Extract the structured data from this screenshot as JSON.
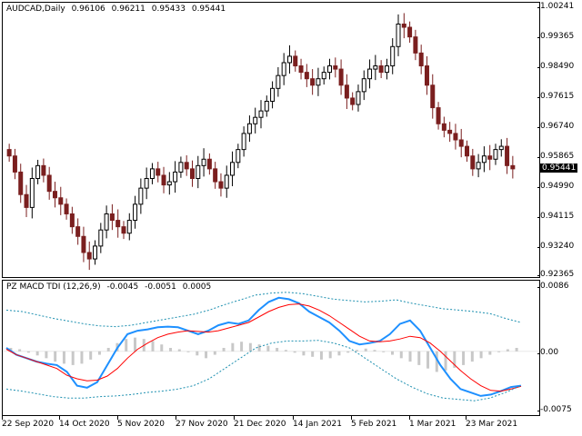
{
  "main_chart": {
    "symbol_label": "AUDCAD,Daily",
    "ohlc": {
      "open": "0.96106",
      "high": "0.96211",
      "low": "0.95433",
      "close": "0.95441"
    },
    "current_price": "0.95441",
    "price_axis_labels": [
      "1.00241",
      "0.99365",
      "0.98490",
      "0.97615",
      "0.96740",
      "0.95865",
      "0.94990",
      "0.94115",
      "0.93240",
      "0.92365"
    ]
  },
  "indicator": {
    "label": "PZ MACD TDI (12,26,9)",
    "values": [
      "-0.0045",
      "-0.0051",
      "0.0005"
    ],
    "axis_labels": [
      "0.0086",
      "0.00",
      "-0.0075"
    ]
  },
  "time_axis_labels": [
    "22 Sep 2020",
    "14 Oct 2020",
    "5 Nov 2020",
    "27 Nov 2020",
    "21 Dec 2020",
    "14 Jan 2021",
    "5 Feb 2021",
    "1 Mar 2021",
    "23 Mar 2021"
  ],
  "colors": {
    "bull_candle": "#000000",
    "bear_candle": "#7a1f1f",
    "fast_line": "#1e90ff",
    "signal_line": "#ff0000",
    "band_line": "#1e90b0",
    "histogram": "#c8c8c8"
  },
  "chart_data": [
    {
      "type": "candlestick",
      "title": "AUDCAD,Daily",
      "ylim": [
        0.9215,
        1.0045
      ],
      "x_labels": [
        "22 Sep 2020",
        "14 Oct 2020",
        "5 Nov 2020",
        "27 Nov 2020",
        "21 Dec 2020",
        "14 Jan 2021",
        "5 Feb 2021",
        "1 Mar 2021",
        "23 Mar 2021"
      ],
      "close_series": [
        0.958,
        0.953,
        0.946,
        0.942,
        0.951,
        0.955,
        0.952,
        0.947,
        0.945,
        0.943,
        0.94,
        0.936,
        0.933,
        0.928,
        0.926,
        0.93,
        0.935,
        0.94,
        0.938,
        0.936,
        0.934,
        0.938,
        0.943,
        0.948,
        0.951,
        0.954,
        0.952,
        0.949,
        0.95,
        0.953,
        0.956,
        0.954,
        0.951,
        0.955,
        0.957,
        0.954,
        0.95,
        0.948,
        0.952,
        0.956,
        0.96,
        0.965,
        0.968,
        0.97,
        0.972,
        0.975,
        0.979,
        0.983,
        0.987,
        0.989,
        0.986,
        0.984,
        0.982,
        0.98,
        0.982,
        0.984,
        0.986,
        0.985,
        0.98,
        0.976,
        0.974,
        0.978,
        0.982,
        0.985,
        0.986,
        0.984,
        0.986,
        0.992,
        0.999,
        0.998,
        0.995,
        0.99,
        0.986,
        0.98,
        0.973,
        0.968,
        0.966,
        0.965,
        0.963,
        0.961,
        0.958,
        0.954,
        0.956,
        0.958,
        0.957,
        0.96,
        0.961,
        0.955,
        0.954
      ]
    },
    {
      "type": "line",
      "title": "PZ MACD TDI (12,26,9)",
      "ylim": [
        -0.0085,
        0.0095
      ],
      "series": [
        {
          "color": "#1e90ff",
          "values": [
            0.0005,
            -0.0005,
            -0.001,
            -0.0015,
            -0.0018,
            -0.002,
            -0.003,
            -0.005,
            -0.0053,
            -0.0045,
            -0.002,
            0.0005,
            0.0025,
            0.003,
            0.0032,
            0.0035,
            0.0036,
            0.0035,
            0.003,
            0.0025,
            0.003,
            0.0038,
            0.0042,
            0.004,
            0.0045,
            0.006,
            0.0072,
            0.0078,
            0.0076,
            0.007,
            0.0058,
            0.005,
            0.0042,
            0.003,
            0.0015,
            0.001,
            0.0012,
            0.0015,
            0.0025,
            0.004,
            0.0045,
            0.003,
            0.0005,
            -0.002,
            -0.004,
            -0.0055,
            -0.006,
            -0.0065,
            -0.0063,
            -0.0058,
            -0.0052,
            -0.005
          ]
        },
        {
          "color": "#ff0000",
          "values": [
            0.0003,
            -0.0005,
            -0.001,
            -0.0015,
            -0.002,
            -0.0025,
            -0.0035,
            -0.004,
            -0.0043,
            -0.0042,
            -0.0036,
            -0.0025,
            -0.001,
            0.0003,
            0.0012,
            0.002,
            0.0025,
            0.0028,
            0.003,
            0.0029,
            0.0028,
            0.003,
            0.0034,
            0.0038,
            0.0042,
            0.005,
            0.0058,
            0.0064,
            0.0068,
            0.0069,
            0.0066,
            0.006,
            0.0052,
            0.0042,
            0.0032,
            0.0022,
            0.0015,
            0.0014,
            0.0015,
            0.0018,
            0.0022,
            0.002,
            0.0012,
            0.0,
            -0.0014,
            -0.0028,
            -0.004,
            -0.005,
            -0.0057,
            -0.0058,
            -0.0055,
            -0.0051
          ]
        },
        {
          "color": "#1e90b0",
          "dashed": true,
          "values": [
            0.006,
            0.0058,
            0.0053,
            0.0048,
            0.0044,
            0.004,
            0.0037,
            0.0036,
            0.0038,
            0.0042,
            0.0046,
            0.005,
            0.0054,
            0.006,
            0.0068,
            0.0075,
            0.0082,
            0.0085,
            0.0086,
            0.0084,
            0.008,
            0.0076,
            0.0074,
            0.0072,
            0.0073,
            0.0075,
            0.007,
            0.0066,
            0.0062,
            0.006,
            0.0058,
            0.0055,
            0.0048,
            0.0042
          ]
        },
        {
          "color": "#1e90b0",
          "dashed": true,
          "values": [
            -0.0055,
            -0.0058,
            -0.0062,
            -0.0066,
            -0.0068,
            -0.0068,
            -0.0066,
            -0.0065,
            -0.0063,
            -0.006,
            -0.0058,
            -0.0055,
            -0.005,
            -0.004,
            -0.0025,
            -0.001,
            0.0005,
            0.0012,
            0.0015,
            0.0015,
            0.0016,
            0.0012,
            0.0005,
            -0.001,
            -0.0025,
            -0.004,
            -0.0052,
            -0.0062,
            -0.0068,
            -0.007,
            -0.0072,
            -0.0068,
            -0.006,
            -0.005
          ]
        }
      ],
      "histogram": [
        0.0005,
        0.0003,
        -0.0002,
        -0.0006,
        -0.001,
        -0.0015,
        -0.0018,
        -0.002,
        -0.0018,
        -0.0012,
        -0.0005,
        0.0005,
        0.0012,
        0.0018,
        0.002,
        0.0018,
        0.0015,
        0.001,
        0.0005,
        0.0003,
        0.0,
        -0.0006,
        -0.001,
        -0.0005,
        0.0005,
        0.0012,
        0.0014,
        0.0012,
        0.001,
        0.0008,
        0.0005,
        0.0002,
        -0.0002,
        -0.0006,
        -0.0008,
        -0.0012,
        -0.001,
        -0.0006,
        -0.0002,
        0.0002,
        0.0004,
        0.0002,
        0.0,
        -0.0005,
        -0.001,
        -0.0015,
        -0.002,
        -0.0025,
        -0.003,
        -0.0028,
        -0.0024,
        -0.002,
        -0.0015,
        -0.001,
        -0.0005,
        0.0,
        0.0003,
        0.0005
      ]
    }
  ]
}
